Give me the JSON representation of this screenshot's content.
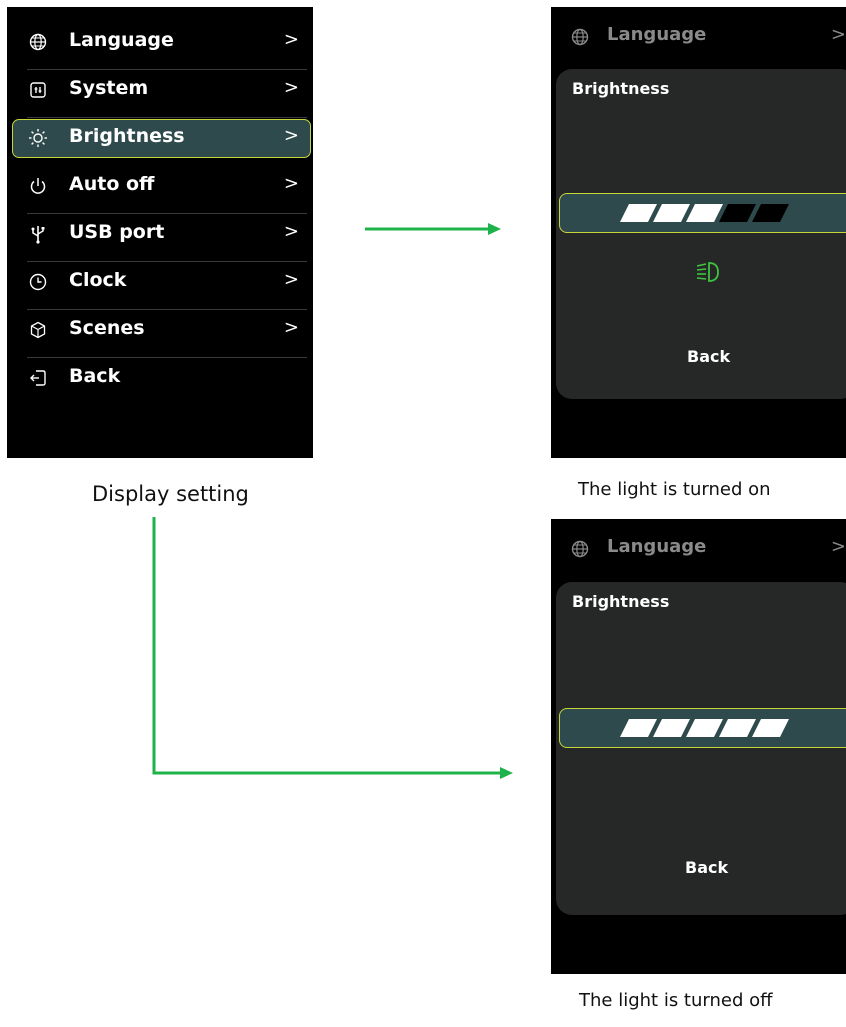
{
  "main_screen": {
    "menu": [
      {
        "label": "Language",
        "icon": "globe-icon",
        "chevron": ">"
      },
      {
        "label": "System",
        "icon": "system-icon",
        "chevron": ">"
      },
      {
        "label": "Brightness",
        "icon": "sun-icon",
        "chevron": ">",
        "selected": true
      },
      {
        "label": "Auto off",
        "icon": "power-icon",
        "chevron": ">"
      },
      {
        "label": "USB port",
        "icon": "usb-icon",
        "chevron": ">"
      },
      {
        "label": "Clock",
        "icon": "clock-icon",
        "chevron": ">"
      },
      {
        "label": "Scenes",
        "icon": "scenes-icon",
        "chevron": ">"
      },
      {
        "label": "Back",
        "icon": "back-icon",
        "chevron": ""
      }
    ],
    "caption": "Display setting"
  },
  "screen_on": {
    "top_label": "Language",
    "top_chevron": ">",
    "title": "Brightness",
    "level_segments_filled": 3,
    "level_segments_total": 5,
    "lamp_icon": "headlight-icon",
    "back_label": "Back",
    "caption": "The light is turned on"
  },
  "screen_off": {
    "top_label": "Language",
    "top_chevron": ">",
    "title": "Brightness",
    "level_segments_filled": 5,
    "level_segments_total": 5,
    "back_label": "Back",
    "caption": "The light is turned off"
  },
  "colors": {
    "highlight_bg": "#2e4a4c",
    "highlight_border": "#c8d63a",
    "arrow": "#1db34a",
    "lamp": "#3ec43e",
    "segment_on": "#ffffff",
    "segment_off": "#000000"
  }
}
